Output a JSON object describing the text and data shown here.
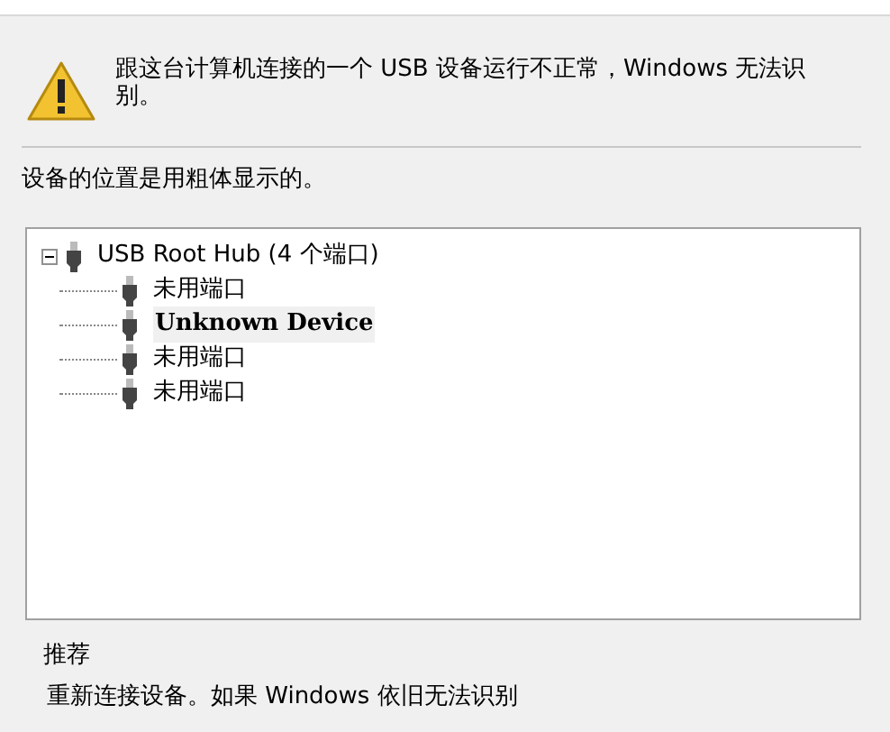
{
  "message": "跟这台计算机连接的一个 USB 设备运行不正常，Windows 无法识别。",
  "location_note": "设备的位置是用粗体显示的。",
  "tree": [
    {
      "label": "USB Root Hub (4 个端口)",
      "expanded": true,
      "bold": false,
      "children": [
        {
          "label": "未用端口",
          "bold": false
        },
        {
          "label": "Unknown Device",
          "bold": true
        },
        {
          "label": "未用端口",
          "bold": false
        },
        {
          "label": "未用端口",
          "bold": false
        }
      ]
    }
  ],
  "recommendation": {
    "heading": "推荐",
    "text": "重新连接设备。如果 Windows 依旧无法识别"
  }
}
